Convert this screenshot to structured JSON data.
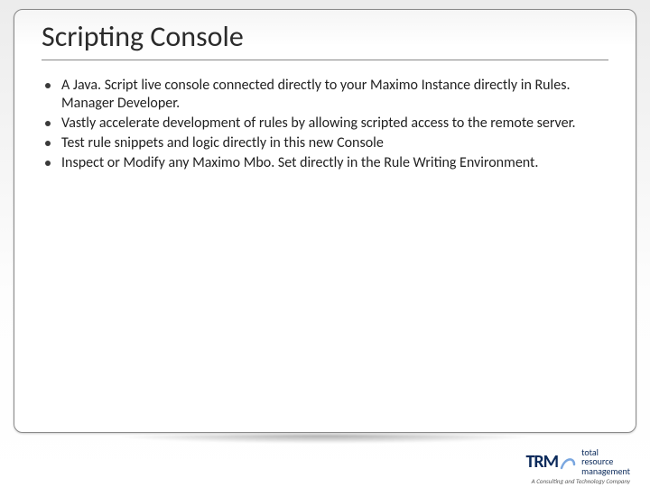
{
  "slide": {
    "title": "Scripting Console",
    "bullets": [
      "A Java. Script live console connected directly to your Maximo Instance directly in Rules. Manager Developer.",
      "Vastly accelerate development of rules by allowing scripted access to the remote server.",
      "Test rule snippets and logic directly in this new Console",
      "Inspect or Modify any Maximo Mbo. Set directly in the Rule Writing Environment."
    ]
  },
  "logo": {
    "initials": "TRM",
    "line1": "total",
    "line2": "resource",
    "line3": "management",
    "tagline": "A Consulting and Technology Company"
  }
}
